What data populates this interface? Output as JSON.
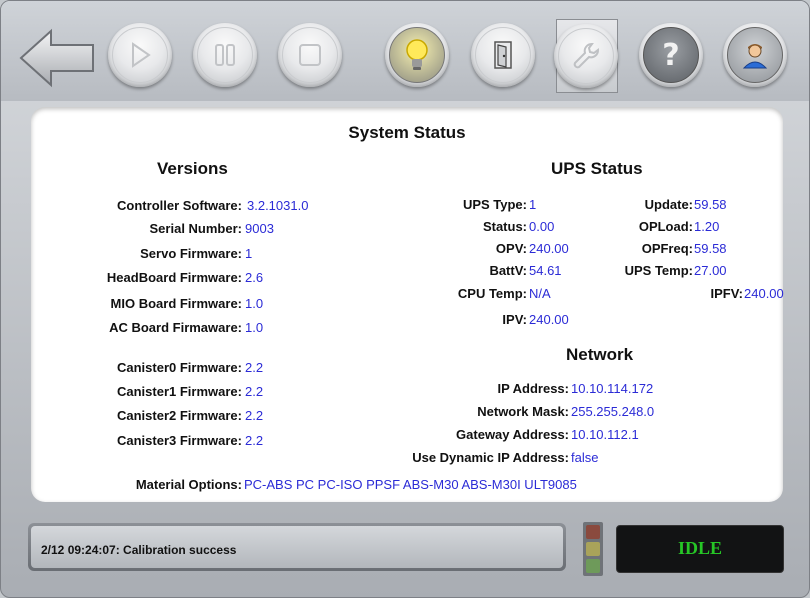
{
  "panel_title": "System Status",
  "versions": {
    "heading": "Versions",
    "rows": [
      {
        "label": "Controller Software:",
        "value": "3.2.1031.0"
      },
      {
        "label": "Serial Number:",
        "value": "9003"
      },
      {
        "label": "Servo Firmware:",
        "value": "1"
      },
      {
        "label": "HeadBoard Firmware:",
        "value": "2.6"
      },
      {
        "label": "MIO Board Firmware:",
        "value": "1.0"
      },
      {
        "label": "AC Board Firmaware:",
        "value": "1.0"
      }
    ],
    "canisters": [
      {
        "label": "Canister0 Firmware:",
        "value": "2.2"
      },
      {
        "label": "Canister1 Firmware:",
        "value": "2.2"
      },
      {
        "label": "Canister2 Firmware:",
        "value": "2.2"
      },
      {
        "label": "Canister3 Firmware:",
        "value": "2.2"
      }
    ]
  },
  "ups": {
    "heading": "UPS Status",
    "left": [
      {
        "label": "UPS Type:",
        "value": "1"
      },
      {
        "label": "Status:",
        "value": "0.00"
      },
      {
        "label": "OPV:",
        "value": "240.00"
      },
      {
        "label": "BattV:",
        "value": "54.61"
      },
      {
        "label": "CPU Temp:",
        "value": "N/A"
      },
      {
        "label": "IPV:",
        "value": "240.00"
      }
    ],
    "right": [
      {
        "label": "Update:",
        "value": "59.58"
      },
      {
        "label": "OPLoad:",
        "value": "1.20"
      },
      {
        "label": "OPFreq:",
        "value": "59.58"
      },
      {
        "label": "UPS Temp:",
        "value": "27.00"
      },
      {
        "label": "IPFV:",
        "value": "240.00"
      }
    ]
  },
  "network": {
    "heading": "Network",
    "rows": [
      {
        "label": "IP Address:",
        "value": "10.10.114.172"
      },
      {
        "label": "Network Mask:",
        "value": "255.255.248.0"
      },
      {
        "label": "Gateway Address:",
        "value": "10.10.112.1"
      },
      {
        "label": "Use Dynamic IP Address:",
        "value": "false"
      }
    ]
  },
  "material": {
    "label": "Material Options:",
    "value": "PC-ABS PC PC-ISO PPSF ABS-M30 ABS-M30I ULT9085"
  },
  "status_message": "2/12 09:24:07: Calibration success",
  "machine_state": "IDLE",
  "toolbar": {
    "icons": [
      "back-arrow-icon",
      "play-icon",
      "pause-icon",
      "stop-icon",
      "lightbulb-icon",
      "door-icon",
      "wrench-icon",
      "help-icon",
      "user-icon"
    ]
  },
  "colors": {
    "value_text": "#2b2bd6",
    "state_text": "#26c626",
    "state_bg": "#121314"
  }
}
